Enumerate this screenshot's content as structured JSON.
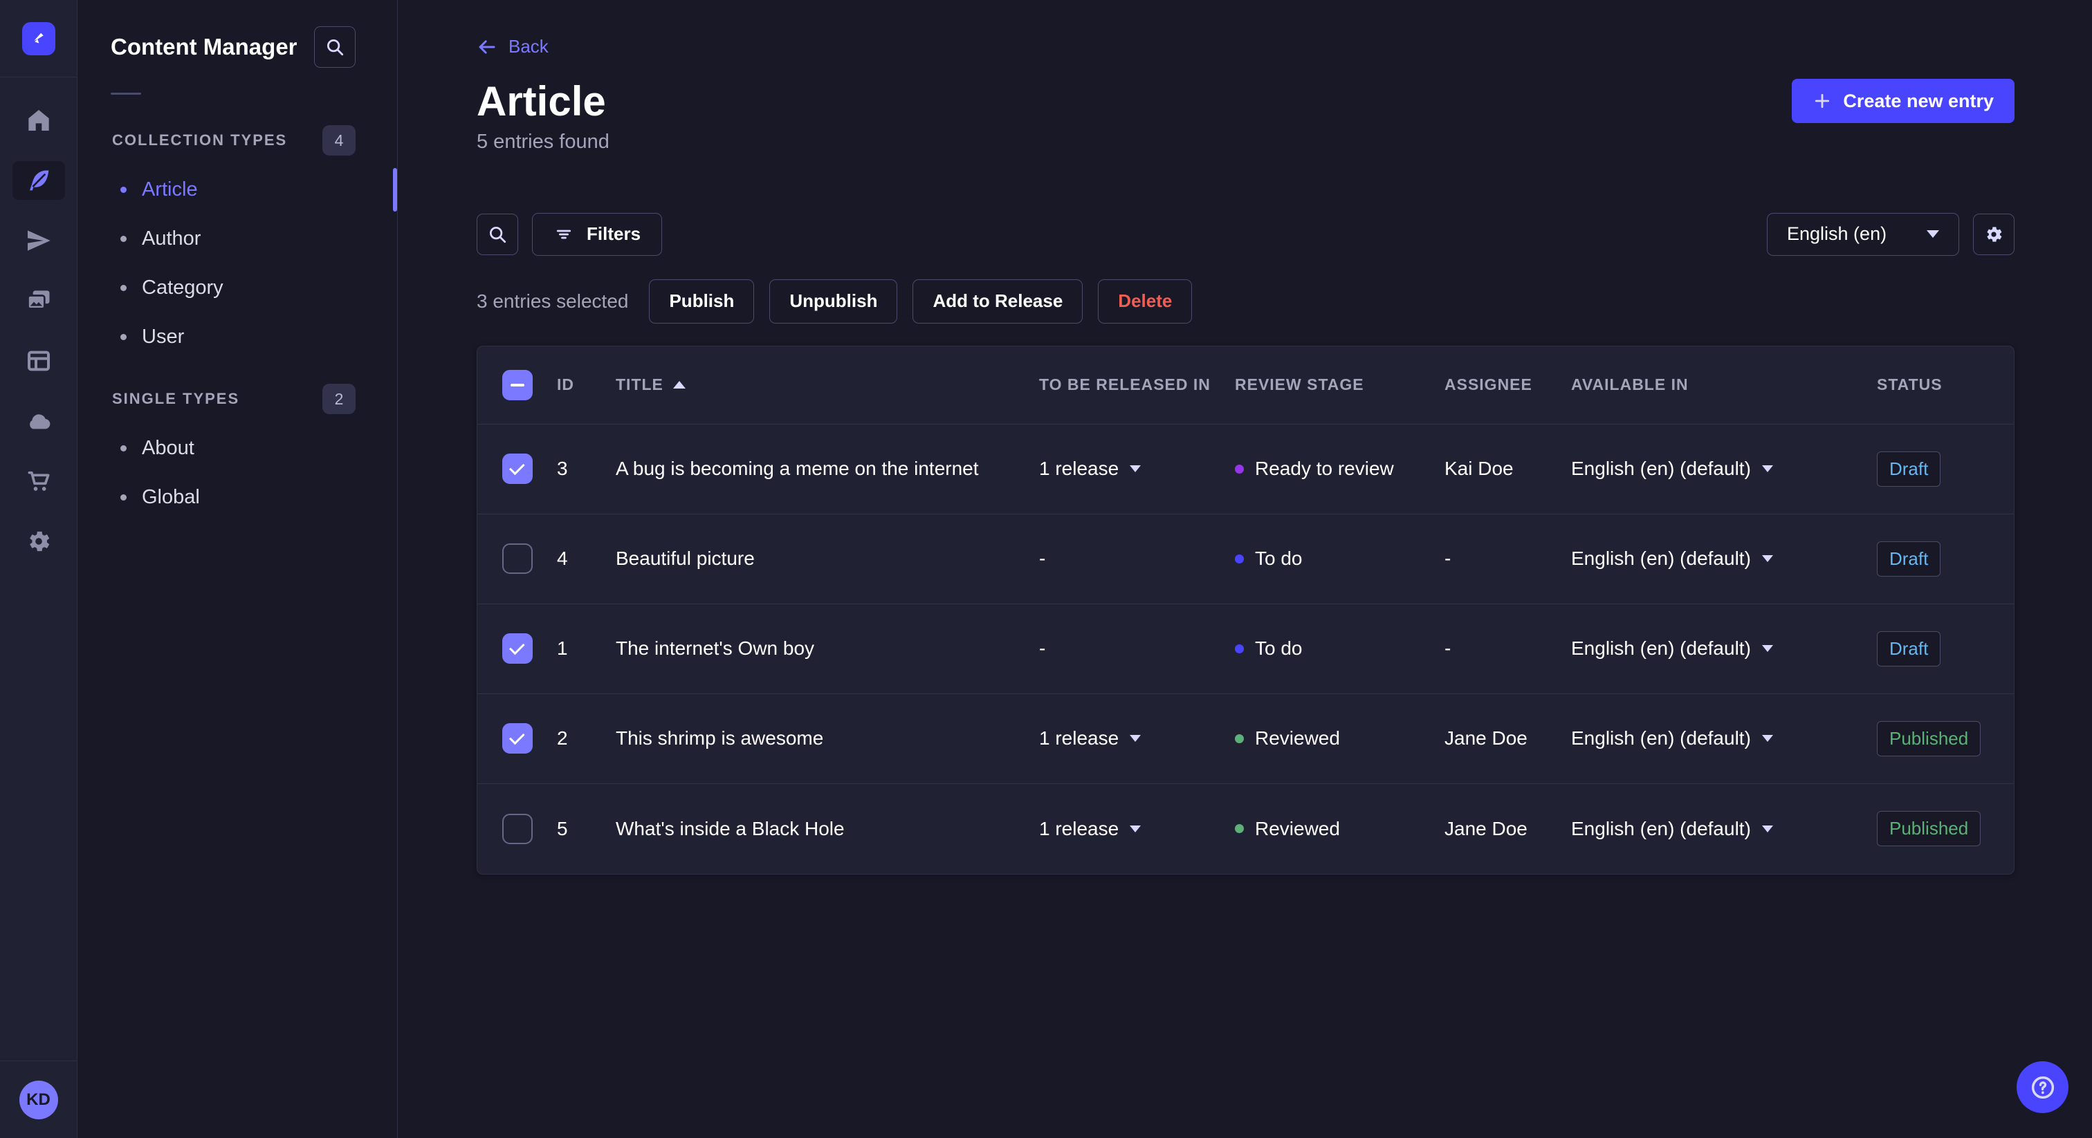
{
  "theme": {
    "bg": "#181826",
    "surface": "#212134",
    "border": "#2e2e45",
    "accent": "#4945ff",
    "accent_light": "#7b79ff",
    "text_muted": "#a5a5ba",
    "danger": "#ee5e52",
    "success": "#5cb176",
    "draft_blue": "#66b7f1"
  },
  "rail": {
    "logo_icon": "strapi-logo",
    "items": [
      {
        "name": "nav-home",
        "icon": "home-icon",
        "active": false
      },
      {
        "name": "nav-content-manager",
        "icon": "feather-icon",
        "active": true
      },
      {
        "name": "nav-releases",
        "icon": "paper-plane-icon",
        "active": false
      },
      {
        "name": "nav-media-library",
        "icon": "media-icon",
        "active": false
      },
      {
        "name": "nav-content-type-builder",
        "icon": "layout-icon",
        "active": false
      },
      {
        "name": "nav-deploy",
        "icon": "cloud-icon",
        "active": false
      },
      {
        "name": "nav-marketplace",
        "icon": "cart-icon",
        "active": false
      },
      {
        "name": "nav-settings",
        "icon": "gear-icon",
        "active": false
      }
    ],
    "avatar_initials": "KD"
  },
  "sidebar": {
    "title": "Content Manager",
    "sections": [
      {
        "label": "COLLECTION TYPES",
        "badge": "4",
        "items": [
          {
            "label": "Article",
            "active": true
          },
          {
            "label": "Author",
            "active": false
          },
          {
            "label": "Category",
            "active": false
          },
          {
            "label": "User",
            "active": false
          }
        ]
      },
      {
        "label": "SINGLE TYPES",
        "badge": "2",
        "items": [
          {
            "label": "About",
            "active": false
          },
          {
            "label": "Global",
            "active": false
          }
        ]
      }
    ]
  },
  "header": {
    "back_label": "Back",
    "title": "Article",
    "subtitle": "5 entries found",
    "create_button": "Create new entry"
  },
  "toolbar": {
    "filters_label": "Filters",
    "locale": "English (en)"
  },
  "selection": {
    "text": "3 entries selected",
    "actions": [
      {
        "label": "Publish",
        "danger": false
      },
      {
        "label": "Unpublish",
        "danger": false
      },
      {
        "label": "Add to Release",
        "danger": false
      },
      {
        "label": "Delete",
        "danger": true
      }
    ]
  },
  "table": {
    "columns": [
      "ID",
      "TITLE",
      "TO BE RELEASED IN",
      "REVIEW STAGE",
      "ASSIGNEE",
      "AVAILABLE IN",
      "STATUS"
    ],
    "sort": {
      "column": "TITLE",
      "direction": "asc"
    },
    "rows": [
      {
        "checked": true,
        "id": "3",
        "title": "A bug is becoming a meme on the internet",
        "release": "1 release",
        "review_stage": "Ready to review",
        "review_color": "#9736e8",
        "assignee": "Kai Doe",
        "available": "English (en) (default)",
        "status": "Draft"
      },
      {
        "checked": false,
        "id": "4",
        "title": "Beautiful picture",
        "release": "-",
        "review_stage": "To do",
        "review_color": "#4945ff",
        "assignee": "-",
        "available": "English (en) (default)",
        "status": "Draft"
      },
      {
        "checked": true,
        "id": "1",
        "title": "The internet's Own boy",
        "release": "-",
        "review_stage": "To do",
        "review_color": "#4945ff",
        "assignee": "-",
        "available": "English (en) (default)",
        "status": "Draft"
      },
      {
        "checked": true,
        "id": "2",
        "title": "This shrimp is awesome",
        "release": "1 release",
        "review_stage": "Reviewed",
        "review_color": "#5cb176",
        "assignee": "Jane Doe",
        "available": "English (en) (default)",
        "status": "Published"
      },
      {
        "checked": false,
        "id": "5",
        "title": "What's inside a Black Hole",
        "release": "1 release",
        "review_stage": "Reviewed",
        "review_color": "#5cb176",
        "assignee": "Jane Doe",
        "available": "English (en) (default)",
        "status": "Published"
      }
    ]
  },
  "help": {
    "glyph": "?"
  }
}
